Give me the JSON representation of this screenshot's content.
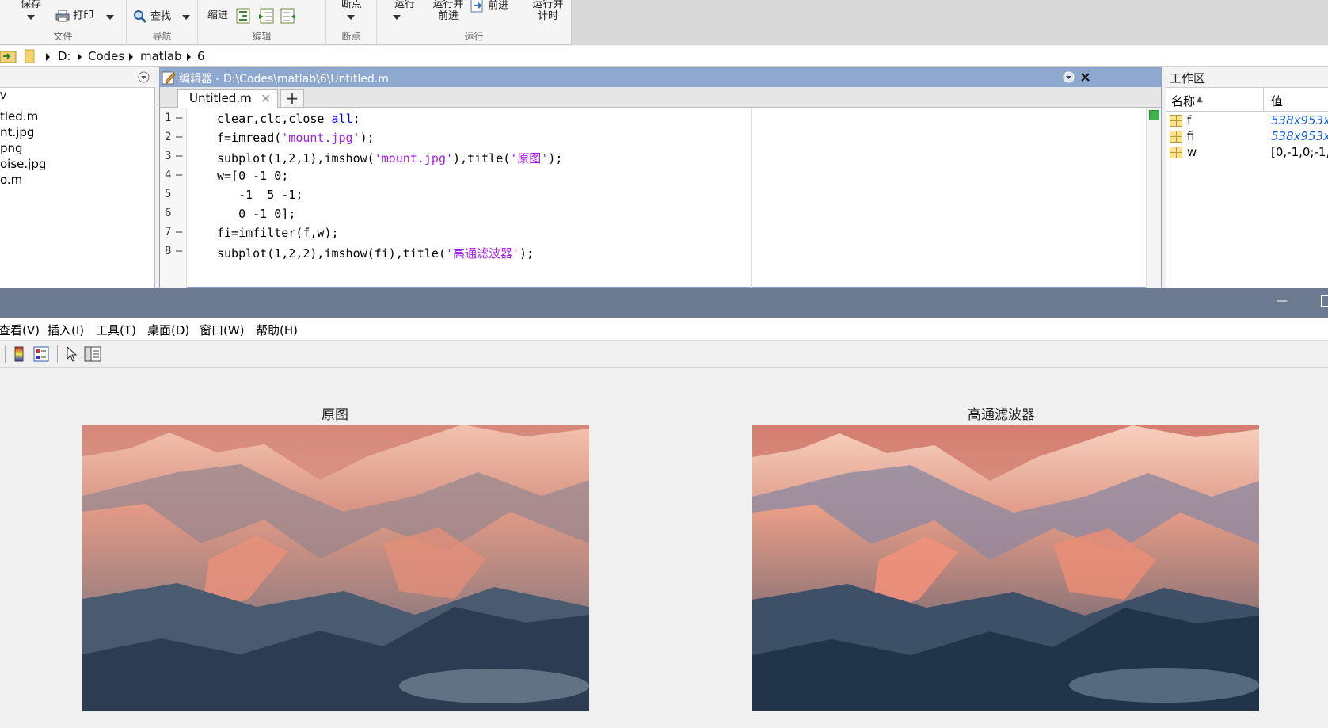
{
  "toolstrip": {
    "save_label": "保存",
    "print_label": "打印",
    "find_label": "查找",
    "indent_label": "缩进",
    "breakpoint_label": "断点",
    "run_label": "运行",
    "run_advance_line1": "运行并",
    "run_advance_line2": "前进",
    "advance_label": "前进",
    "run_time_line1": "运行并",
    "run_time_line2": "计时",
    "groups": {
      "file": "文件",
      "nav": "导航",
      "edit": "编辑",
      "breakpoints": "断点",
      "run": "运行"
    }
  },
  "address": {
    "parts": [
      "D:",
      "Codes",
      "matlab",
      "6"
    ]
  },
  "files": {
    "items": [
      "tled.m",
      "nt.jpg",
      "png",
      "oise.jpg",
      "o.m"
    ]
  },
  "editor": {
    "title": "编辑器 - D:\\Codes\\matlab\\6\\Untitled.m",
    "tab": "Untitled.m",
    "tab_add": "+",
    "line_numbers": [
      "1",
      "2",
      "3",
      "4",
      "5",
      "6",
      "7",
      "8"
    ],
    "code": {
      "l1a": "clear,clc,close ",
      "l1kw": "all",
      "l1b": ";",
      "l2a": "f=imread(",
      "l2s": "'mount.jpg'",
      "l2b": ");",
      "l3a": "subplot(1,2,1),imshow(",
      "l3s": "'mount.jpg'",
      "l3b": "),title(",
      "l3s2": "'原图'",
      "l3c": ");",
      "l4": "w=[0 -1 0;",
      "l5": "   -1  5 -1;",
      "l6": "   0 -1 0];",
      "l7": "fi=imfilter(f,w);",
      "l8a": "subplot(1,2,2),imshow(fi),title(",
      "l8s": "'高通滤波器'",
      "l8b": ");"
    }
  },
  "workspace": {
    "title": "工作区",
    "col_name": "名称",
    "col_value": "值",
    "vars": [
      {
        "name": "f",
        "value": "538x953x"
      },
      {
        "name": "fi",
        "value": "538x953x"
      },
      {
        "name": "w",
        "value": "[0,-1,0;-1,"
      }
    ]
  },
  "figure": {
    "menu": [
      "查看(V)",
      "插入(I)",
      "工具(T)",
      "桌面(D)",
      "窗口(W)",
      "帮助(H)"
    ],
    "titles": {
      "left": "原图",
      "right": "高通滤波器"
    },
    "minimize_glyph": "—"
  }
}
